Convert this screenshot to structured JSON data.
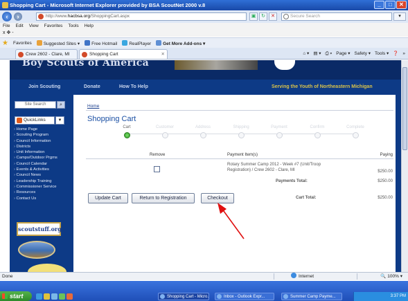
{
  "window": {
    "title": "Shopping Cart - Microsoft Internet Explorer provided by BSA ScoutNet 2000 v.8",
    "controls": [
      "_",
      "□",
      "✕"
    ]
  },
  "address_bar": {
    "url_prefix": "http://www.",
    "url_host": "hacbsa.org",
    "url_path": "/ShoppingCart.aspx",
    "search_placeholder": "Secure Search"
  },
  "menu": {
    "items": [
      "File",
      "Edit",
      "View",
      "Favorites",
      "Tools",
      "Help"
    ],
    "second_row": "x  ✥ -"
  },
  "favorites_bar": {
    "label": "Favorites",
    "items": [
      "Suggested Sites ▾",
      "Free Hotmail",
      "RealPlayer",
      "Get More Add-ons ▾"
    ]
  },
  "tabs": [
    {
      "label": "Crew 2602 - Clare, MI"
    },
    {
      "label": "Shopping Cart"
    }
  ],
  "command_bar": [
    "Page ▾",
    "Safety ▾",
    "Tools ▾",
    "»"
  ],
  "site": {
    "org_name": "Boy Scouts of America",
    "nav": [
      "Join Scouting",
      "Donate",
      "How To Help"
    ],
    "tagline": "Serving the Youth of Northeastern Michigan",
    "search_label": "Site Search",
    "quicklinks_label": "QuickLinks",
    "side_links": [
      "Home Page",
      "Scouting Program",
      "Council Information",
      "Districts",
      "Unit Information",
      "Camps/Outdoor Prgms",
      "Council Calendar",
      "Events & Activities",
      "Council News",
      "Leadership Training",
      "Commissioner Service",
      "Resources",
      "Contact Us"
    ],
    "scoutstuff": "scoutstuff.org"
  },
  "cart": {
    "breadcrumb": "Home",
    "title": "Shopping Cart",
    "steps": [
      "Cart",
      "Customer",
      "Address",
      "Shipping",
      "Payment",
      "Confirm",
      "Complete"
    ],
    "active_step": 0,
    "headers": {
      "remove": "Remove",
      "item": "Payment Item(s)",
      "paying": "Paying"
    },
    "item_description": "Rotary Summer Camp 2012 - Week #7 (Unit/Troop Registration) / Crew 2602 - Clare, MI",
    "item_amount": "$250.00",
    "payments_total_label": "Payments Total:",
    "payments_total": "$250.00",
    "cart_total_label": "Cart Total:",
    "cart_total": "$250.00",
    "buttons": {
      "update": "Update Cart",
      "return": "Return to Registration",
      "checkout": "Checkout"
    },
    "annotation_color": "#e01010"
  },
  "status_bar": {
    "text": "Done",
    "zone": "Internet",
    "zoom": "100%"
  },
  "taskbar": {
    "start": "start",
    "buttons": [
      "Shopping Cart - Micro...",
      "Inbox - Outlook Expr...",
      "Summer Camp Payme..."
    ],
    "clock": "3:37 PM"
  }
}
